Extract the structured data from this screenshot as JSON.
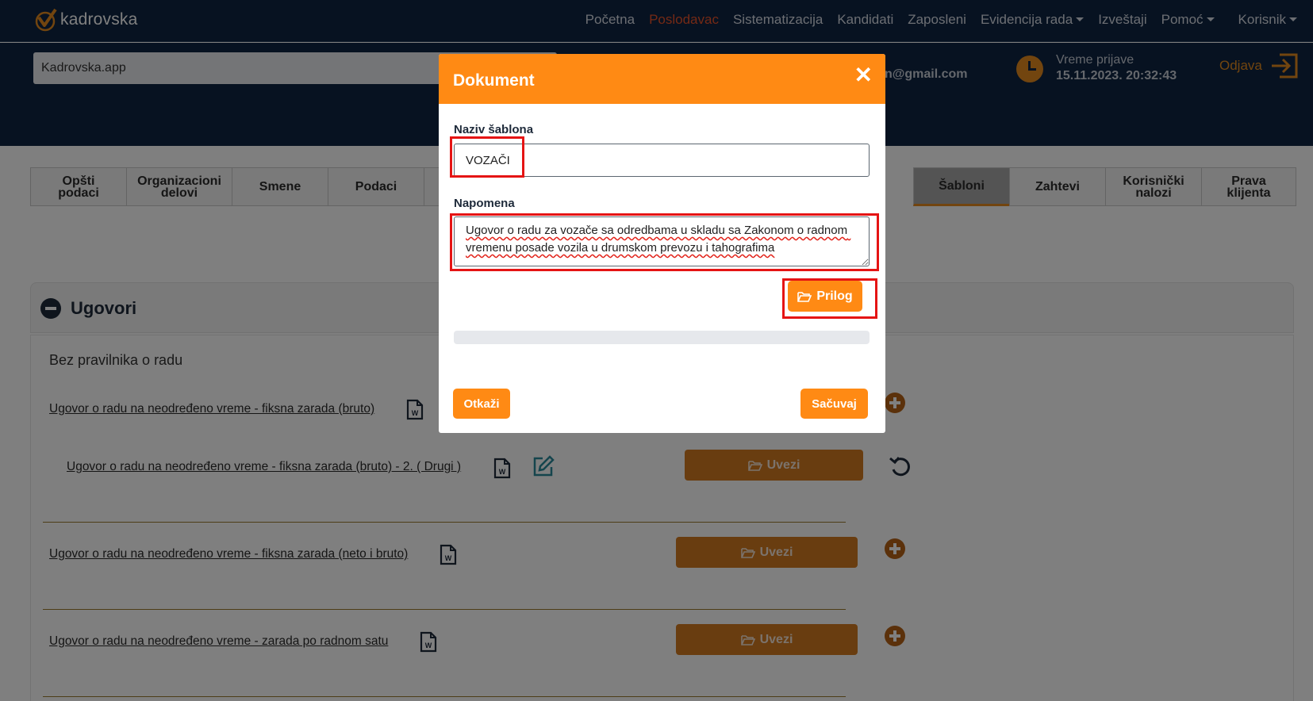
{
  "app": {
    "logo_text": "kadrovska"
  },
  "nav": {
    "items": [
      {
        "label": "Početna",
        "active": false,
        "dropdown": false
      },
      {
        "label": "Poslodavac",
        "active": true,
        "dropdown": false
      },
      {
        "label": "Sistematizacija",
        "active": false,
        "dropdown": false
      },
      {
        "label": "Kandidati",
        "active": false,
        "dropdown": false
      },
      {
        "label": "Zaposleni",
        "active": false,
        "dropdown": false
      },
      {
        "label": "Evidencija rada",
        "active": false,
        "dropdown": true
      },
      {
        "label": "Izveštaji",
        "active": false,
        "dropdown": false
      },
      {
        "label": "Pomoć",
        "active": false,
        "dropdown": true
      }
    ],
    "user_label": "Korisnik"
  },
  "header": {
    "company_value": "Kadrovska.app",
    "email_fragment": "n@gmail.com",
    "login_label": "Vreme prijave",
    "login_time": "15.11.2023. 20:32:43",
    "logout_label": "Odjava"
  },
  "tabs": [
    {
      "label": "Opšti podaci",
      "active": false
    },
    {
      "label": "Organizacioni delovi",
      "active": false
    },
    {
      "label": "Smene",
      "active": false
    },
    {
      "label": "Podaci",
      "active": false
    },
    {
      "label": "",
      "active": false
    },
    {
      "label": "Šabloni",
      "active": true
    },
    {
      "label": "Zahtevi",
      "active": false
    },
    {
      "label": "Korisnički nalozi",
      "active": false
    },
    {
      "label": "Prava klijenta",
      "active": false
    }
  ],
  "section": {
    "title": "Ugovori",
    "subheading": "Bez pravilnika o radu",
    "docs": [
      "Ugovor o radu na neodređeno vreme - fiksna zarada (bruto)",
      "Ugovor o radu na neodređeno vreme - fiksna zarada (bruto) - 2. ( Drugi )",
      "Ugovor o radu na neodređeno vreme - fiksna zarada (neto i bruto)",
      "Ugovor o radu na neodređeno vreme - zarada po radnom satu"
    ],
    "import_label": "Uvezi"
  },
  "modal": {
    "title": "Dokument",
    "close_glyph": "✕",
    "name_label": "Naziv šablona",
    "name_value": "VOZAČI",
    "note_label": "Napomena",
    "note_value": "Ugovor o radu za vozače sa odredbama u skladu sa Zakonom o radnom vremenu posade vozila u drumskom prevozu i tahografima",
    "attach_label": "Prilog",
    "progress_percent": 0,
    "cancel_label": "Otkaži",
    "save_label": "Sačuvaj"
  },
  "colors": {
    "nav_bg": "#0e2542",
    "accent": "#ff8a14",
    "active_nav": "#e8522a",
    "highlight": "#e51414"
  }
}
